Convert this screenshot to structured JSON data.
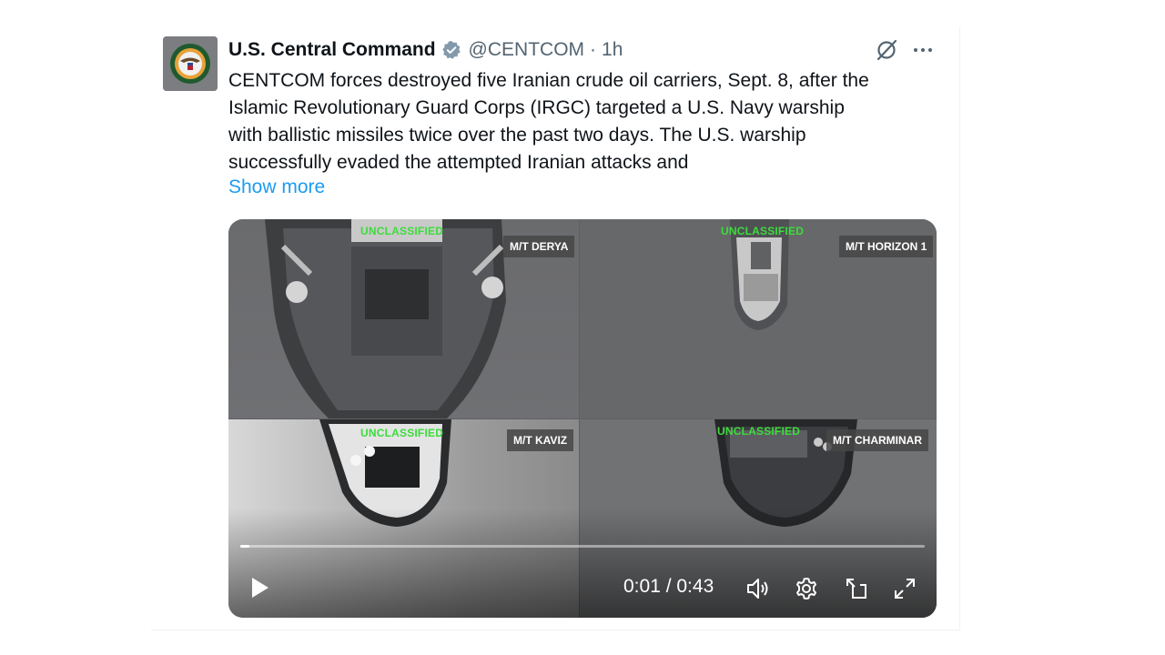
{
  "tweet": {
    "author_name": "U.S. Central Command",
    "handle": "@CENTCOM",
    "separator": "·",
    "time": "1h",
    "text_lines": [
      "CENTCOM forces destroyed five Iranian crude oil carriers, Sept. 8, after the",
      "Islamic Revolutionary Guard Corps (IRGC) targeted a U.S. Navy warship",
      "with ballistic missiles twice over the past two days. The U.S. warship",
      "successfully evaded the attempted Iranian attacks and"
    ],
    "show_more": "Show more"
  },
  "icons": {
    "verified": "verified-badge-icon",
    "grok": "grok-icon",
    "more": "more-icon"
  },
  "video": {
    "quadrants": [
      {
        "classification": "UNCLASSIFIED",
        "vessel": "M/T DERYA"
      },
      {
        "classification": "UNCLASSIFIED",
        "vessel": "M/T HORIZON 1"
      },
      {
        "classification": "UNCLASSIFIED",
        "vessel": "M/T KAVIZ"
      },
      {
        "classification": "UNCLASSIFIED",
        "vessel": "M/T CHARMINAR"
      }
    ],
    "elapsed": "0:01",
    "duration": "0:43",
    "time_display": "0:01 / 0:43",
    "progress_fraction": 0.013,
    "controls": [
      "play-icon",
      "volume-icon",
      "settings-icon",
      "pip-icon",
      "fullscreen-icon"
    ]
  },
  "colors": {
    "accent": "#1d9bf0",
    "text": "#0f1419",
    "muted": "#536471",
    "overlay_green": "#3cdc3c"
  }
}
